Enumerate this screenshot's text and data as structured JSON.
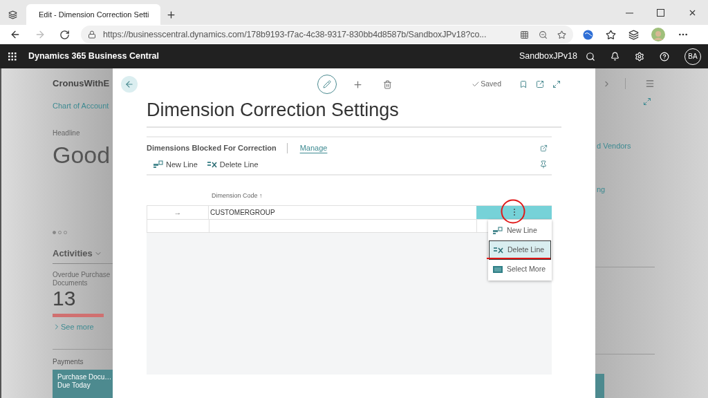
{
  "browser": {
    "tab": {
      "title": "Edit - Dimension Correction Setti",
      "selected": true
    },
    "url": "https://businesscentral.dynamics.com/178b9193-f7ac-4c38-9317-830bb4d8587b/SandboxJPv18?co..."
  },
  "app_bar": {
    "title": "Dynamics 365 Business Central",
    "environment": "SandboxJPv18",
    "avatar": "BA"
  },
  "background_page": {
    "company": "CronusWithE",
    "nav_link": "Chart of Account",
    "headline_label": "Headline",
    "headline": "Good",
    "page_dots": [
      {
        "selected": true
      },
      {
        "selected": false
      },
      {
        "selected": false
      }
    ],
    "activities": "Activities",
    "cue": {
      "label": "Overdue Purchase Documents",
      "value": "13",
      "link": "See more"
    },
    "payments": "Payments",
    "tile": [
      "Purchase Docu…",
      "Due Today"
    ],
    "right_texts": [
      "d Vendors",
      "ng"
    ]
  },
  "dialog": {
    "status": "Saved",
    "title": "Dimension Correction Settings",
    "part": {
      "title": "Dimensions Blocked For Correction",
      "manage": "Manage",
      "actions": [
        "New Line",
        "Delete Line"
      ],
      "column": "Dimension Code ↑",
      "rows": [
        {
          "indicator": "→",
          "dimension_code": "CUSTOMERGROUP",
          "selected": true
        }
      ]
    },
    "context_menu": [
      {
        "label": "New Line",
        "kind": "new",
        "selected": false
      },
      {
        "label": "Delete Line",
        "kind": "delete",
        "selected": true
      },
      {
        "label": "Select More",
        "kind": "select",
        "selected": false
      }
    ]
  }
}
